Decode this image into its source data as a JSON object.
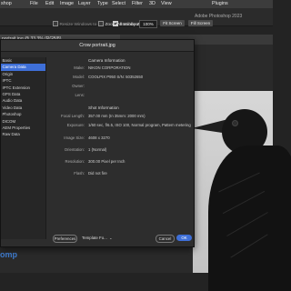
{
  "menubar": {
    "items": [
      "shop",
      "File",
      "Edit",
      "Image",
      "Layer",
      "Type",
      "Select",
      "Filter",
      "3D",
      "View",
      "Plugins"
    ]
  },
  "options_bar": {
    "resize_windows": "Resize Windows to Fit",
    "zoom_all": "Zoom All Windows",
    "scrubby_zoom": "Scrubby Zoom",
    "zoom_value": "100%",
    "fit_screen": "Fit Screen",
    "fill_screen": "Fill Screen",
    "app_title": "Adobe Photoshop 2023"
  },
  "document_tab": {
    "label": "portrait.jpg @ 33.3% (RGB/8)"
  },
  "dialog": {
    "title": "Crow portrait.jpg",
    "sidebar": [
      "Basic",
      "Camera Data",
      "Origin",
      "IPTC",
      "IPTC Extension",
      "GPS Data",
      "Audio Data",
      "Video Data",
      "Photoshop",
      "DICOM",
      "AEM Properties",
      "Raw Data"
    ],
    "selected_index": 1,
    "camera_info": {
      "title": "Camera Information",
      "rows": [
        {
          "label": "Make:",
          "value": "NIKON CORPORATION"
        },
        {
          "label": "Model:",
          "value": "COOLPIX P950   S/N: 50352650"
        },
        {
          "label": "Owner:",
          "value": ""
        },
        {
          "label": "Lens:",
          "value": ""
        }
      ]
    },
    "shot_info": {
      "title": "Shot Information",
      "rows": [
        {
          "label": "Focal Length:",
          "value": "357.00 mm   (In 35mm: 2000 mm)"
        },
        {
          "label": "Exposure:",
          "value": "1/60 sec,  f/6.5,  ISO 100,  Normal program,  Pattern metering"
        },
        {
          "label": "Image Size:",
          "value": "4608 x 3270"
        },
        {
          "label": "Orientation:",
          "value": "1 (Normal)"
        },
        {
          "label": "Resolution:",
          "value": "300.00 Pixel per Inch"
        },
        {
          "label": "Flash:",
          "value": "Did not fire"
        }
      ]
    },
    "buttons": {
      "preferences": "Preferences",
      "template": "Template Fo...",
      "cancel": "Cancel",
      "ok": "OK"
    }
  },
  "watermark": "omp",
  "colors": {
    "accent": "#3e6fd8",
    "menubar_bg": "#3c3c3c",
    "dialog_bg": "#2d2d2d"
  }
}
